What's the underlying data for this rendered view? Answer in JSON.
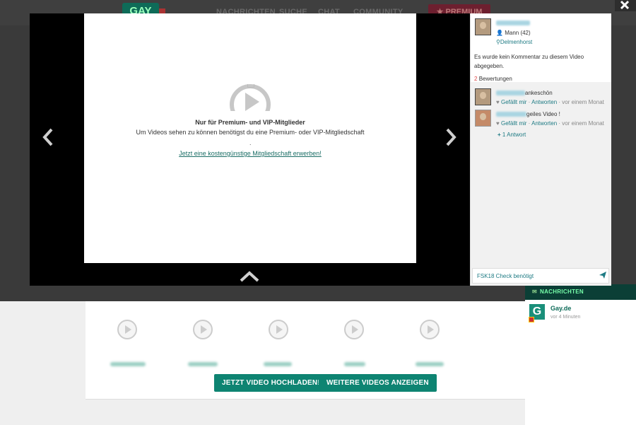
{
  "site": {
    "logo": "GAY",
    "nav": [
      "NACHRICHTEN",
      "SUCHE",
      "CHAT",
      "COMMUNITY"
    ],
    "premium": "PREMIUM",
    "buttons": {
      "upload": "JETZT VIDEO HOCHLADEN!",
      "more": "WEITERE VIDEOS ANZEIGEN"
    }
  },
  "messages": {
    "header": "NACHRICHTEN",
    "items": [
      {
        "title": "Gay.de",
        "time": "vor 4 Minuten",
        "icon_letter": "G"
      }
    ]
  },
  "player": {
    "title": "Nur für Premium- und VIP-Mitglieder",
    "text": "Um Videos sehen zu können benötigst du eine Premium- oder VIP-Mitgliedschaft",
    "dot": ".",
    "link": "Jetzt eine kostengünstige Mitgliedschaft erwerben!"
  },
  "side": {
    "uploader": {
      "gender_age": "Mann (42)",
      "city": "Delmenhorst"
    },
    "no_comment": "Es wurde kein Kommentar zu diesem Video abgegeben.",
    "ratings": {
      "count": "2",
      "label": "Bewertungen"
    },
    "comments": [
      {
        "text": "ankeschön",
        "like": "Gefällt mir",
        "sep": "·",
        "reply": "Antworten",
        "time": "· vor einem Monat"
      },
      {
        "text": "geiles Video !",
        "like": "Gefällt mir",
        "sep": "·",
        "reply": "Antworten",
        "time": "· vor einem Monat"
      }
    ],
    "replies": "1 Antwort",
    "input_placeholder": "FSK18 Check benötigt"
  },
  "colors": {
    "teal": "#0e8472",
    "link": "#1d7a83",
    "dark": "#3a3a3a"
  }
}
